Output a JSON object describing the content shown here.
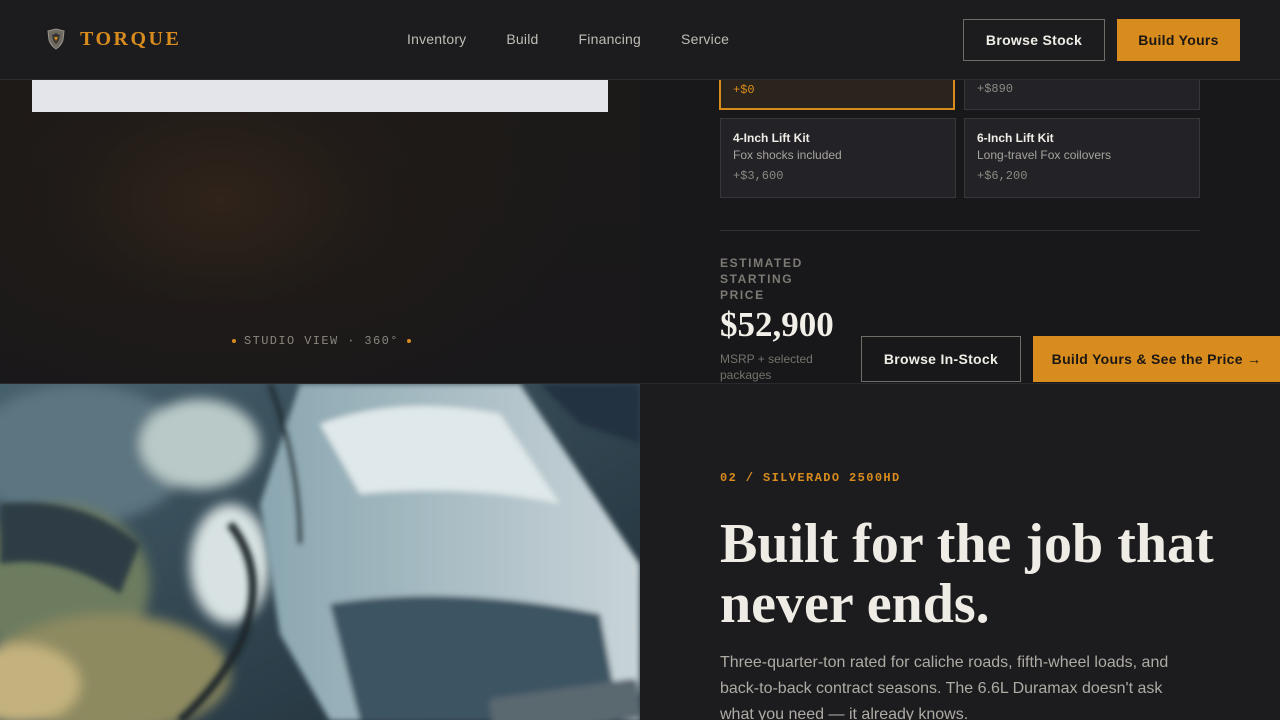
{
  "brand": {
    "name": "TORQUE",
    "icon": "shield-crest-icon"
  },
  "nav": {
    "items": [
      "Inventory",
      "Build",
      "Financing",
      "Service"
    ]
  },
  "header_actions": {
    "browse": "Browse Stock",
    "build": "Build Yours"
  },
  "studio": {
    "caption": "STUDIO VIEW · 360°"
  },
  "options": [
    {
      "title": "",
      "subtitle": "",
      "price": "+$0",
      "selected": true
    },
    {
      "title": "",
      "subtitle": "",
      "price": "+$890",
      "selected": false
    },
    {
      "title": "4-Inch Lift Kit",
      "subtitle": "Fox shocks included",
      "price": "+$3,600",
      "selected": false
    },
    {
      "title": "6-Inch Lift Kit",
      "subtitle": "Long-travel Fox coilovers",
      "price": "+$6,200",
      "selected": false
    }
  ],
  "estimate": {
    "label": "ESTIMATED STARTING PRICE",
    "price": "$52,900",
    "note": "MSRP + selected packages"
  },
  "cta": {
    "browse": "Browse In-Stock",
    "build": "Build Yours & See the Price →"
  },
  "feature": {
    "eyebrow": "02 / SILVERADO 2500HD",
    "headline": "Built for the job that never ends.",
    "body": "Three-quarter-ton rated for caliche roads, fifth-wheel loads, and back-to-back contract seasons. The 6.6L Duramax doesn't ask what you need — it already knows."
  },
  "colors": {
    "accent": "#d98c1e",
    "background": "#1b1b1e",
    "text": "#efece5"
  }
}
